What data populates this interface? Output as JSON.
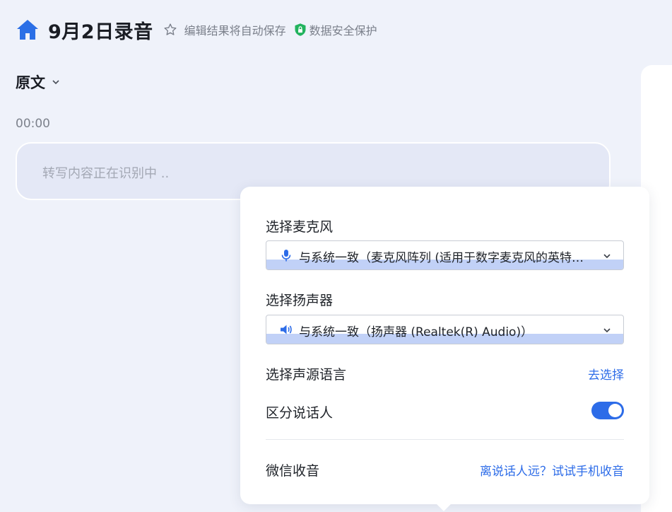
{
  "header": {
    "title": "9月2日录音",
    "save_note": "编辑结果将自动保存",
    "secure_note": "数据安全保护",
    "icons": [
      "home-icon",
      "star-icon",
      "shield-lock-icon"
    ]
  },
  "view": {
    "label": "原文"
  },
  "transcript": {
    "timestamp": "00:00",
    "placeholder": "转写内容正在识别中 .."
  },
  "popover": {
    "mic": {
      "label": "选择麦克风",
      "value": "与系统一致（麦克风阵列 (适用于数字麦克风的英特尔® 智音技术)）",
      "icon": "microphone-icon"
    },
    "speaker": {
      "label": "选择扬声器",
      "value": "与系统一致（扬声器 (Realtek(R) Audio)）",
      "icon": "speaker-icon"
    },
    "language": {
      "label": "选择声源语言",
      "link": "去选择"
    },
    "diarization": {
      "label": "区分说话人",
      "enabled": true
    },
    "wechat": {
      "label": "微信收音",
      "link": "离说话人远？试试手机收音"
    }
  },
  "colors": {
    "accent": "#2d6ce8",
    "home_icon": "#2b6fe6",
    "shield": "#22b35e",
    "background": "#eff2fa"
  }
}
